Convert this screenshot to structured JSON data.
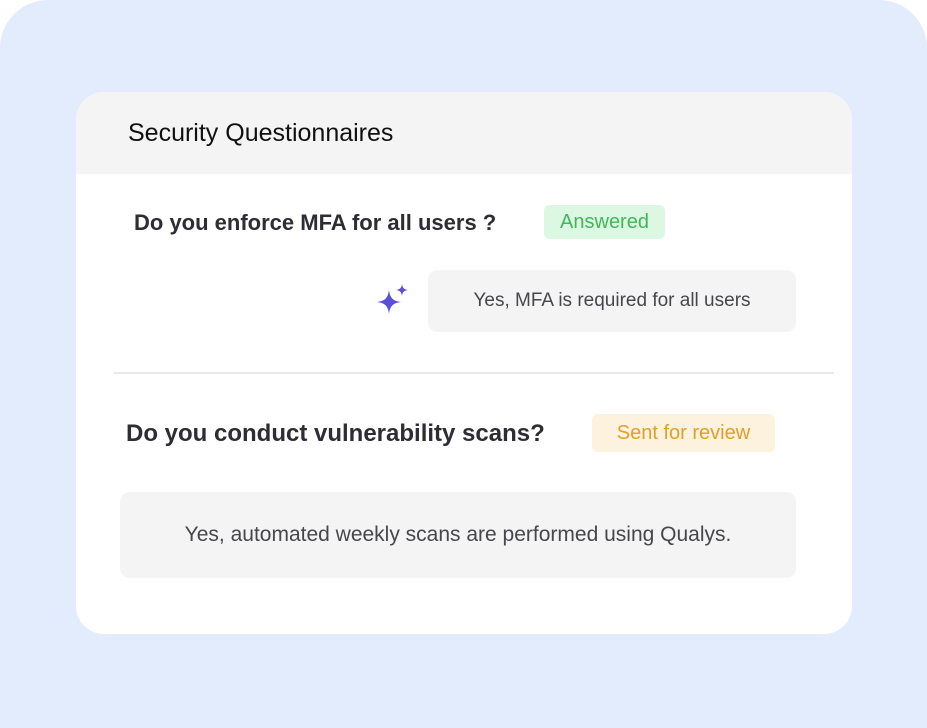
{
  "card": {
    "title": "Security Questionnaires"
  },
  "questions": [
    {
      "question": "Do you enforce MFA for all users ?",
      "status": "Answered",
      "status_color": "#3fb85a",
      "status_bg": "#dcf7e2",
      "answer": "Yes, MFA is required for all users",
      "icon": "sparkle-icon"
    },
    {
      "question": "Do you conduct vulnerability scans?",
      "status": "Sent for review",
      "status_color": "#e0a02a",
      "status_bg": "#fdf2dd",
      "answer": "Yes, automated weekly scans are performed using Qualys."
    }
  ],
  "colors": {
    "backdrop": "#e3ecfd",
    "sparkle": "#5b4fd8"
  }
}
